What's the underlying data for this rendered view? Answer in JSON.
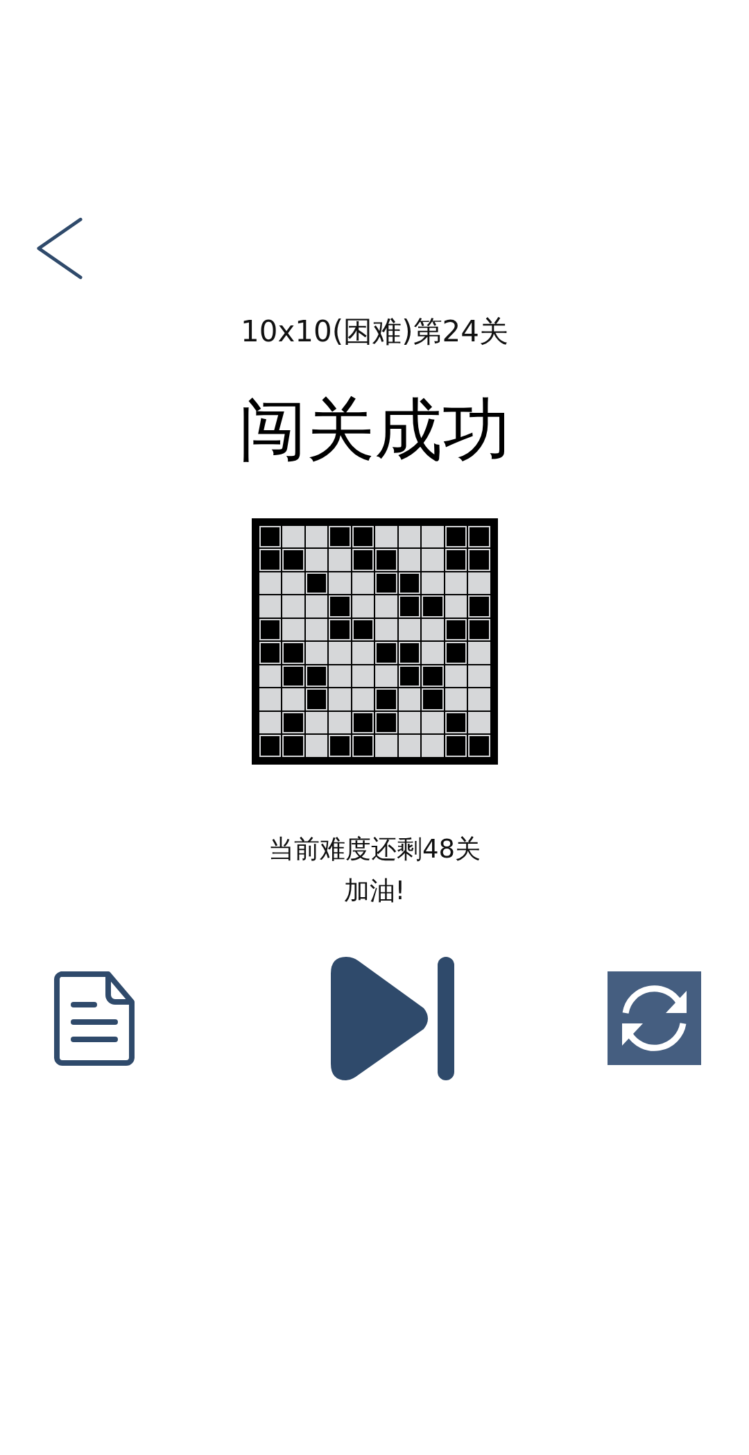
{
  "level_title": "10x10(困难)第24关",
  "result_title": "闯关成功",
  "grid": {
    "rows": [
      [
        true,
        false,
        false,
        true,
        true,
        false,
        false,
        false,
        true,
        true
      ],
      [
        true,
        true,
        false,
        false,
        true,
        true,
        false,
        false,
        true,
        true
      ],
      [
        false,
        false,
        true,
        false,
        false,
        true,
        true,
        false,
        false,
        false
      ],
      [
        false,
        false,
        false,
        true,
        false,
        false,
        true,
        true,
        false,
        true
      ],
      [
        true,
        false,
        false,
        true,
        true,
        false,
        false,
        false,
        true,
        true
      ],
      [
        true,
        true,
        false,
        false,
        false,
        true,
        true,
        false,
        true,
        false
      ],
      [
        false,
        true,
        true,
        false,
        false,
        false,
        true,
        true,
        false,
        false
      ],
      [
        false,
        false,
        true,
        false,
        false,
        true,
        false,
        true,
        false,
        false
      ],
      [
        false,
        true,
        false,
        false,
        true,
        true,
        false,
        false,
        true,
        false
      ],
      [
        true,
        true,
        false,
        true,
        true,
        false,
        false,
        false,
        true,
        true
      ]
    ]
  },
  "message_lines": [
    "当前难度还剩48关",
    "加油!"
  ]
}
